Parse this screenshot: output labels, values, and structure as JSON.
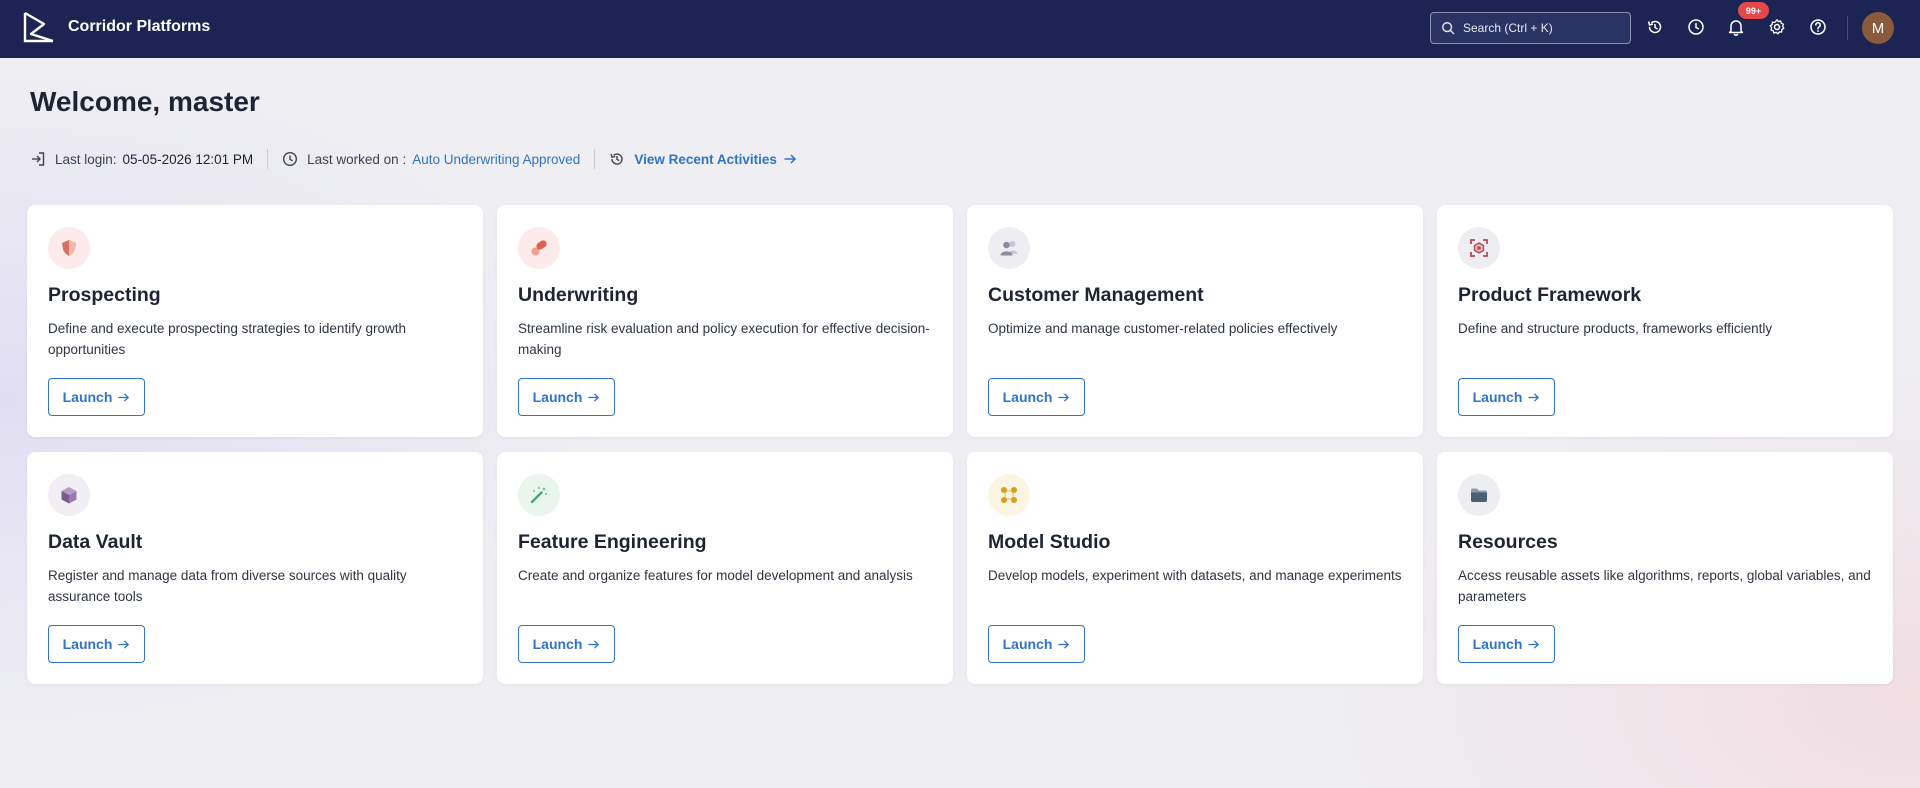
{
  "header": {
    "brand": "Corridor Platforms",
    "search_placeholder": "Search (Ctrl + K)",
    "notifications_badge": "99+",
    "avatar_initial": "M"
  },
  "welcome": {
    "title": "Welcome, master",
    "last_login_label": "Last login:",
    "last_login_value": "05-05-2026 12:01 PM",
    "last_worked_label": "Last worked on :",
    "last_worked_value": "Auto Underwriting Approved",
    "view_recent": "View Recent Activities"
  },
  "launch_label": "Launch",
  "cards": [
    {
      "title": "Prospecting",
      "desc": "Define and execute prospecting strategies to identify growth opportunities",
      "icon": "shield-icon",
      "icon_bg": "#fcebea",
      "icon_color": "#d9705f"
    },
    {
      "title": "Underwriting",
      "desc": "Streamline risk evaluation and policy execution for effective decision-making",
      "icon": "pill-icon",
      "icon_bg": "#fcebea",
      "icon_color": "#e0604f"
    },
    {
      "title": "Customer Management",
      "desc": "Optimize and manage customer-related policies effectively",
      "icon": "users-icon",
      "icon_bg": "#eeeef2",
      "icon_color": "#8b8ea3"
    },
    {
      "title": "Product Framework",
      "desc": "Define and structure products, frameworks efficiently",
      "icon": "scan-icon",
      "icon_bg": "#eeeef2",
      "icon_color": "#b14b55"
    },
    {
      "title": "Data Vault",
      "desc": "Register and manage data from diverse sources with quality assurance tools",
      "icon": "cube-icon",
      "icon_bg": "#f1eef4",
      "icon_color": "#7b5c8c"
    },
    {
      "title": "Feature Engineering",
      "desc": "Create and organize features for model development and analysis",
      "icon": "magic-wand-icon",
      "icon_bg": "#eaf5ee",
      "icon_color": "#4aa872"
    },
    {
      "title": "Model Studio",
      "desc": "Develop models, experiment with datasets, and manage experiments",
      "icon": "nodes-icon",
      "icon_bg": "#fdf5e4",
      "icon_color": "#d4a21c"
    },
    {
      "title": "Resources",
      "desc": "Access reusable assets like algorithms, reports, global variables, and parameters",
      "icon": "folder-icon",
      "icon_bg": "#eceef2",
      "icon_color": "#4b5e73"
    }
  ]
}
